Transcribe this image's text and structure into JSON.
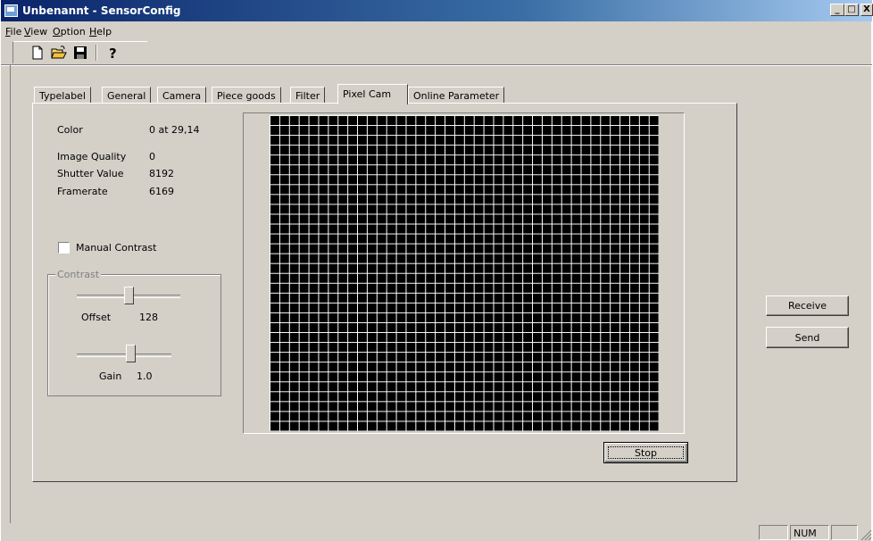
{
  "window": {
    "title": "Unbenannt - SensorConfig",
    "minimize": "_",
    "maximize": "□",
    "close": "X"
  },
  "menu": [
    {
      "key": "F",
      "rest": "ile"
    },
    {
      "key": "V",
      "rest": "iew"
    },
    {
      "key": "O",
      "rest": "ption"
    },
    {
      "key": "H",
      "rest": "elp"
    }
  ],
  "toolbar": {
    "icons": [
      "new-file-icon",
      "open-folder-icon",
      "save-disk-icon",
      "help-question-icon"
    ]
  },
  "tabs": [
    "Typelabel",
    "General",
    "Camera",
    "Piece goods",
    "Filter",
    "Pixel Cam",
    "Online Parameter"
  ],
  "active_tab": "Pixel Cam",
  "info": {
    "color_label": "Color",
    "color_value": "0 at 29,14",
    "quality_label": "Image Quality",
    "quality_value": "0",
    "shutter_label": "Shutter Value",
    "shutter_value": "8192",
    "framerate_label": "Framerate",
    "framerate_value": "6169"
  },
  "manual_contrast": {
    "label": "Manual Contrast",
    "checked": false
  },
  "contrast": {
    "title": "Contrast",
    "offset_label": "Offset",
    "offset_value": "128",
    "gain_label": "Gain",
    "gain_value": "1.0"
  },
  "buttons": {
    "stop": "Stop",
    "receive": "Receive",
    "send": "Send"
  },
  "status": {
    "num": "NUM"
  }
}
